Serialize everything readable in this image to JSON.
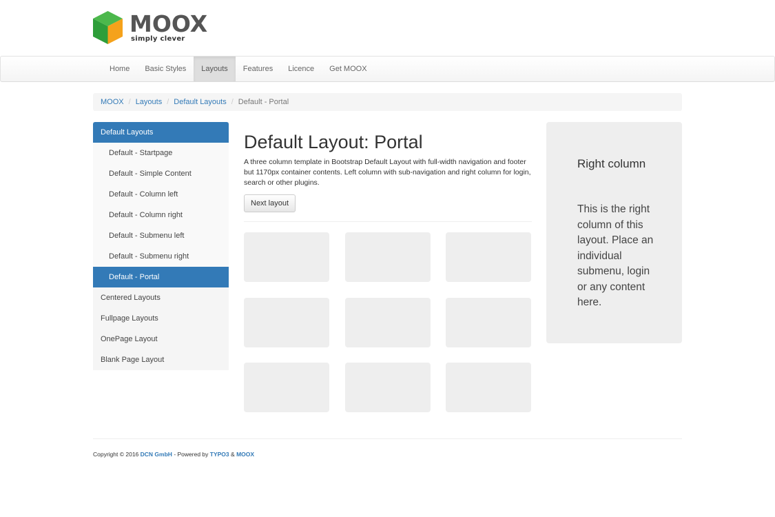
{
  "brand": {
    "name": "MOOX",
    "tagline": "simply clever",
    "logo_icon": "cube-icon",
    "colors": {
      "green": "#3aa63a",
      "orange": "#f39c12",
      "text": "#555555"
    }
  },
  "nav": {
    "items": [
      {
        "label": "Home"
      },
      {
        "label": "Basic Styles"
      },
      {
        "label": "Layouts",
        "active": true
      },
      {
        "label": "Features"
      },
      {
        "label": "Licence"
      },
      {
        "label": "Get MOOX"
      }
    ]
  },
  "breadcrumb": {
    "items": [
      {
        "label": "MOOX"
      },
      {
        "label": "Layouts"
      },
      {
        "label": "Default Layouts"
      }
    ],
    "separator": "/",
    "current": "Default - Portal"
  },
  "sidebar": {
    "header": "Default Layouts",
    "subitems": [
      {
        "label": "Default - Startpage"
      },
      {
        "label": "Default - Simple Content"
      },
      {
        "label": "Default - Column left"
      },
      {
        "label": "Default - Column right"
      },
      {
        "label": "Default - Submenu left"
      },
      {
        "label": "Default - Submenu right"
      },
      {
        "label": "Default - Portal",
        "active": true
      }
    ],
    "items": [
      {
        "label": "Centered Layouts"
      },
      {
        "label": "Fullpage Layouts"
      },
      {
        "label": "OnePage Layout"
      },
      {
        "label": "Blank Page Layout"
      }
    ]
  },
  "main": {
    "title": "Default Layout: Portal",
    "description": "A three column template in Bootstrap Default Layout with full-width navigation and footer but 1170px container contents. Left column with sub-navigation and right column for login, search or other plugins.",
    "next_button": "Next layout"
  },
  "right_column": {
    "title": "Right column",
    "text": "This is the right column of this layout. Place an individual submenu, login or any content here."
  },
  "footer": {
    "prefix": "Copyright © 2016",
    "company": "DCN GmbH",
    "middle": "- Powered by",
    "typo3": "TYPO3",
    "amp": "&",
    "moox": "MOOX"
  },
  "accent_color": "#337ab7"
}
